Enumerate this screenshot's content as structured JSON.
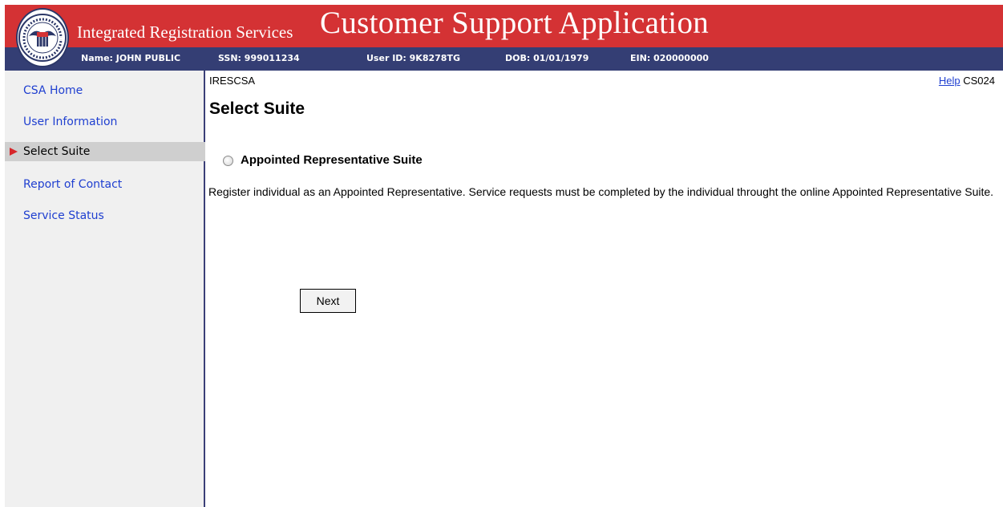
{
  "header": {
    "system_title": "Integrated Registration Services",
    "app_title": "Customer Support Application",
    "seal": {
      "lettering": "SOCIAL SECURITY ADMINISTRATION USA"
    },
    "info": {
      "name": "Name: JOHN PUBLIC",
      "ssn": "SSN: 999011234",
      "user_id": "User ID: 9K8278TG",
      "dob": "DOB: 01/01/1979",
      "ein": "EIN: 020000000"
    }
  },
  "sidebar": {
    "items": [
      {
        "label": "CSA Home",
        "active": false
      },
      {
        "label": "User Information",
        "active": false
      },
      {
        "label": "Select Suite",
        "active": true
      },
      {
        "label": "Report of Contact",
        "active": false
      },
      {
        "label": "Service Status",
        "active": false
      }
    ]
  },
  "main": {
    "app_code": "IRESCSA",
    "help_label": "Help",
    "screen_id": "CS024",
    "title": "Select Suite",
    "suite_option": {
      "label": "Appointed Representative Suite",
      "selected": false
    },
    "description": "Register individual as an Appointed Representative. Service requests must be completed by the individual throught the online Appointed Representative Suite.",
    "next_label": "Next"
  },
  "colors": {
    "banner_red": "#d43234",
    "banner_navy": "#343e74",
    "link_blue": "#1f3fd0",
    "active_arrow": "#d7262a",
    "sidebar_bg": "#f0f0f0",
    "active_bg": "#cfcfcf"
  }
}
